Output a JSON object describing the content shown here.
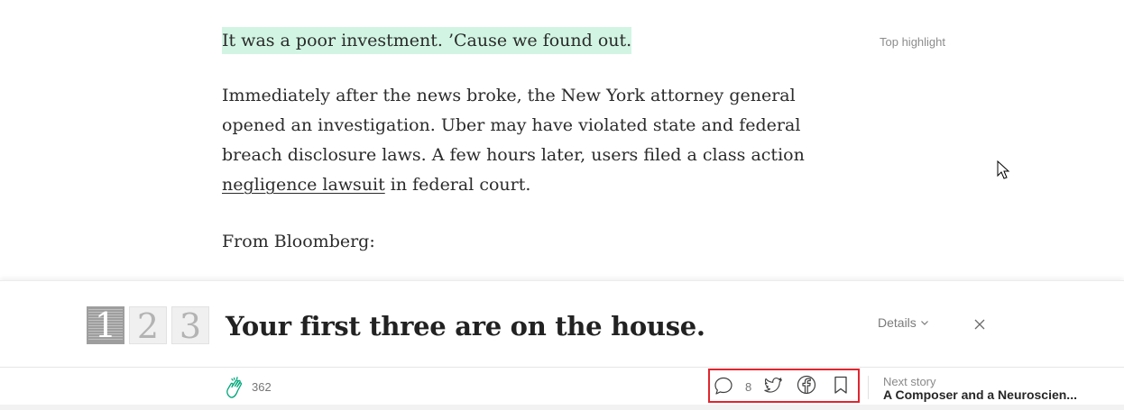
{
  "article": {
    "highlighted_sentence": "It was a poor investment. ’Cause we found out.",
    "top_highlight_label": "Top highlight",
    "paragraph": {
      "before_link": "Immediately after the news broke, the New York attorney general opened an investigation. Uber may have violated state and federal breach disclosure laws. A few hours later, users filed a class action ",
      "link_text": "negligence lawsuit",
      "after_link": " in federal court."
    },
    "from_line": "From Bloomberg:"
  },
  "meter_banner": {
    "tiles": [
      "1",
      "2",
      "3"
    ],
    "title": "Your first three are on the house.",
    "details_label": "Details",
    "icons": {
      "details": "chevron-down-icon",
      "close": "close-icon"
    }
  },
  "action_bar": {
    "clap_count": "362",
    "comment_count": "8",
    "next_story_label": "Next story",
    "next_story_title": "A Composer and a Neuroscien...",
    "icons": {
      "clap": "clap-icon",
      "comment": "comment-icon",
      "twitter": "twitter-icon",
      "facebook": "facebook-icon",
      "bookmark": "bookmark-icon"
    },
    "highlight_box_color": "#e0252f",
    "clap_icon_color": "#03a87c"
  },
  "colors": {
    "highlight_background": "#d2f5e3",
    "text": "#292929",
    "muted": "#8c8c8c"
  }
}
